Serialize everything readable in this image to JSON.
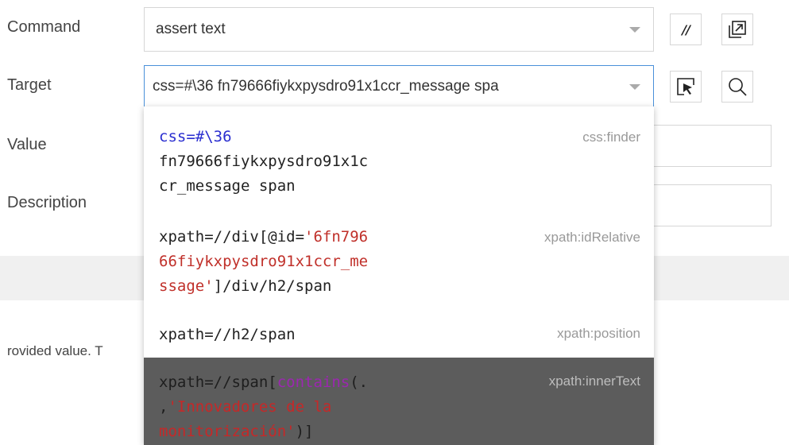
{
  "labels": {
    "command": "Command",
    "target": "Target",
    "value": "Value",
    "description": "Description"
  },
  "command": {
    "value": "assert text",
    "comment_button": "//"
  },
  "target": {
    "value": "css=#\\36 fn79666fiykxpysdro91x1ccr_message spa"
  },
  "background_text": {
    "partial_line": "rovided value. T"
  },
  "target_options": [
    {
      "line1_kw": "css=",
      "line1_rest": "#\\36",
      "line2": "fn79666fiykxpysdro91x1c",
      "line3": "cr_message span",
      "strategy": "css:finder"
    },
    {
      "line1_pre": "xpath=//div[@id=",
      "line1_str": "'6fn796",
      "line2_str": "66fiykxpysdro91x1ccr_me",
      "line3_str": "ssage'",
      "line3_rest": "]/div/h2/span",
      "strategy": "xpath:idRelative"
    },
    {
      "line1": "xpath=//h2/span",
      "strategy": "xpath:position"
    },
    {
      "line1_pre": "xpath=//span[",
      "line1_fn": "contains",
      "line1_post": "(.",
      "line2_pre": ",",
      "line2_str": "'Innovadores de la",
      "line3_str": "monitorización'",
      "line3_rest": ")]",
      "strategy": "xpath:innerText"
    }
  ],
  "colors": {
    "focus_border": "#4a90d9",
    "highlight_bg": "#5c5c5c",
    "keyword": "#2a2ed0",
    "string": "#c0302a"
  }
}
